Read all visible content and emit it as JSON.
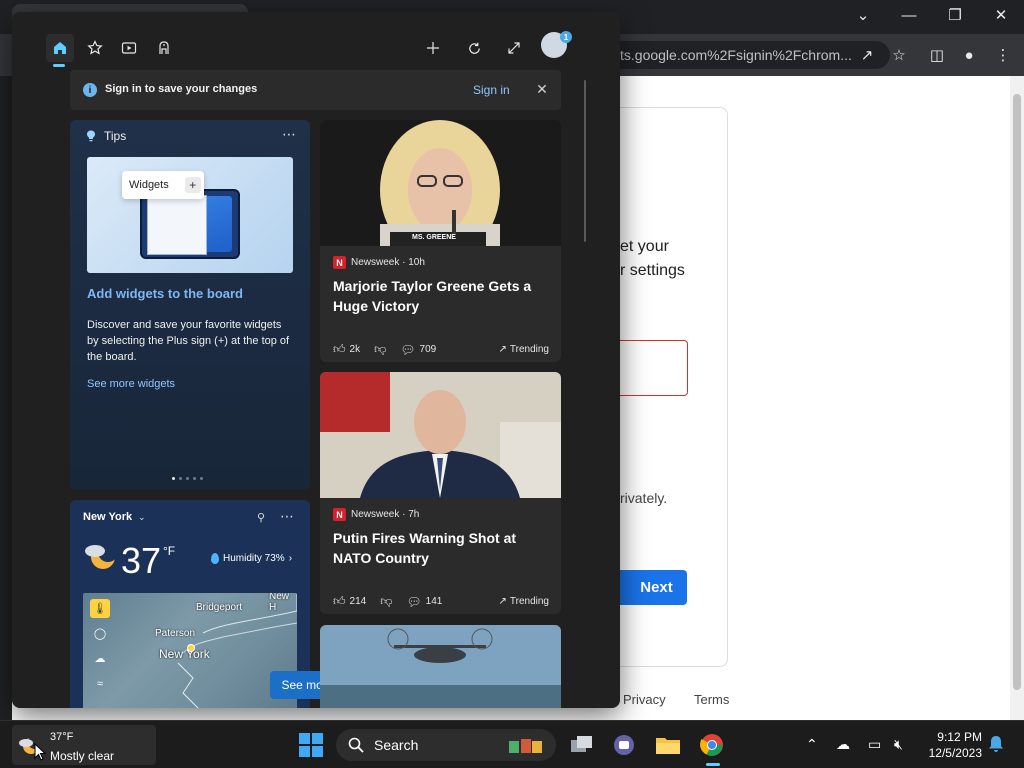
{
  "browser": {
    "omnibox_text": "ts.google.com%2Fsignin%2Fchrom...",
    "page_fragments": {
      "line1": "et your",
      "line2": "r settings",
      "privately": "rivately.",
      "next_button": "Next",
      "privacy": "Privacy",
      "terms": "Terms"
    }
  },
  "widgets": {
    "signin_bar": {
      "text": "Sign in to save your changes",
      "link": "Sign in"
    },
    "avatar_badge": "1",
    "tips": {
      "header": "Tips",
      "chip_label": "Widgets",
      "chip_plus": "+",
      "title": "Add widgets to the board",
      "body": "Discover and save your favorite widgets by selecting the Plus sign (+) at the top of the board.",
      "link": "See more widgets"
    },
    "weather": {
      "location": "New York",
      "temp": "37",
      "unit": "°F",
      "humidity": "Humidity 73%",
      "map_labels": {
        "bridgeport": "Bridgeport",
        "paterson": "Paterson",
        "new_york": "New York",
        "new_h": "New H"
      }
    },
    "see_more": "See more",
    "news": [
      {
        "source": "Newsweek · 10h",
        "headline": "Marjorie Taylor Greene Gets a Huge Victory",
        "likes": "2k",
        "comments": "709",
        "trending": "Trending",
        "caption": "MS. GREENE"
      },
      {
        "source": "Newsweek · 7h",
        "headline": "Putin Fires Warning Shot at NATO Country",
        "likes": "214",
        "comments": "141",
        "trending": "Trending"
      }
    ]
  },
  "taskbar": {
    "weather_temp": "37°F",
    "weather_cond": "Mostly clear",
    "search_label": "Search",
    "time": "9:12 PM",
    "date": "12/5/2023"
  },
  "colors": {
    "accent": "#60cdff",
    "link": "#8fc7ff",
    "newsweek": "#d3222a",
    "google_blue": "#1a73e8"
  }
}
